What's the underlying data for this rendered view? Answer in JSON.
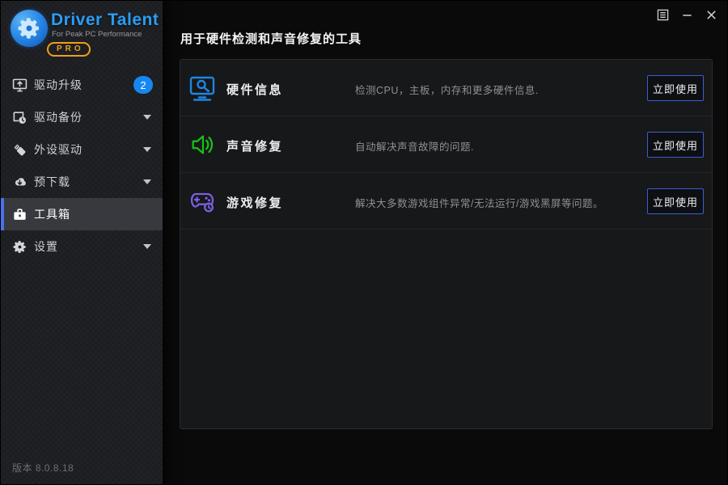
{
  "app": {
    "brand": {
      "name": "Driver Talent",
      "tagline": "For Peak PC Performance",
      "pro_badge": "PRO"
    },
    "version_label": "版本 8.0.8.18"
  },
  "sidebar": {
    "items": [
      {
        "label": "驱动升级",
        "icon": "monitor-upgrade-icon",
        "badge": "2",
        "expandable": false,
        "selected": false
      },
      {
        "label": "驱动备份",
        "icon": "backup-clock-icon",
        "expandable": true,
        "selected": false
      },
      {
        "label": "外设驱动",
        "icon": "usb-drive-icon",
        "expandable": true,
        "selected": false
      },
      {
        "label": "预下载",
        "icon": "cloud-download-icon",
        "expandable": true,
        "selected": false
      },
      {
        "label": "工具箱",
        "icon": "toolbox-icon",
        "expandable": false,
        "selected": true
      },
      {
        "label": "设置",
        "icon": "gear-icon",
        "expandable": true,
        "selected": false
      }
    ]
  },
  "main": {
    "title": "用于硬件检测和声音修复的工具",
    "tools": [
      {
        "name": "硬件信息",
        "description": "检测CPU，主板，内存和更多硬件信息.",
        "icon": "hardware-monitor-search-icon",
        "icon_color": "#1e86e4",
        "action_label": "立即使用"
      },
      {
        "name": "声音修复",
        "description": "自动解决声音故障的问题.",
        "icon": "speaker-sound-icon",
        "icon_color": "#17c317",
        "action_label": "立即使用"
      },
      {
        "name": "游戏修复",
        "description": "解决大多数游戏组件异常/无法运行/游戏黑屏等问题。",
        "icon": "gamepad-repair-icon",
        "icon_color": "#7a5fe0",
        "action_label": "立即使用"
      }
    ]
  },
  "window_controls": {
    "menu": "menu",
    "minimize": "minimize",
    "close": "close"
  },
  "colors": {
    "accent_blue": "#1687f0",
    "selected_border": "#4a72e6",
    "button_border": "#3a5ed2",
    "pro_orange": "#ef9f1c",
    "sidebar_bg": "#1b1d21",
    "panel_bg": "#17181a",
    "main_bg": "#0a0a0b"
  }
}
